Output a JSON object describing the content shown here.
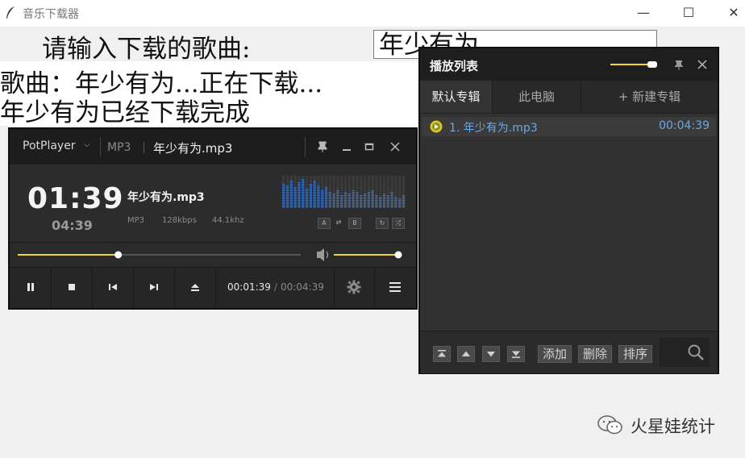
{
  "window": {
    "title": "音乐下载器",
    "minimize_glyph": "—",
    "maximize_glyph": "☐",
    "close_glyph": "✕"
  },
  "form": {
    "prompt_label": "请输入下载的歌曲:",
    "song_entry_value": "年少有为"
  },
  "status": {
    "line1": "歌曲：年少有为...正在下载...",
    "line2": "年少有为已经下载完成"
  },
  "potplayer": {
    "brand": "PotPlayer",
    "format": "MP3",
    "filename": "年少有为.mp3",
    "current_time": "01:39",
    "total_time": "04:39",
    "track_title": "年少有为.mp3",
    "meta_format": "MP3",
    "meta_bitrate": "128kbps",
    "meta_samplerate": "44.1khz",
    "seek_progress": 0.355,
    "volume_level": 1.0,
    "control_time_current": "00:01:39",
    "control_time_separator": "/",
    "control_time_total": "00:04:39",
    "accent_color": "#f3d23c"
  },
  "playlist": {
    "title": "播放列表",
    "tabs": [
      "默认专辑",
      "此电脑",
      "+ 新建专辑"
    ],
    "items": [
      {
        "index_title": "1. 年少有为.mp3",
        "duration": "00:04:39"
      }
    ],
    "buttons": {
      "add": "添加",
      "delete": "删除",
      "sort": "排序"
    },
    "item_color": "#6fa8e0"
  },
  "watermark": {
    "text": "火星娃统计"
  }
}
